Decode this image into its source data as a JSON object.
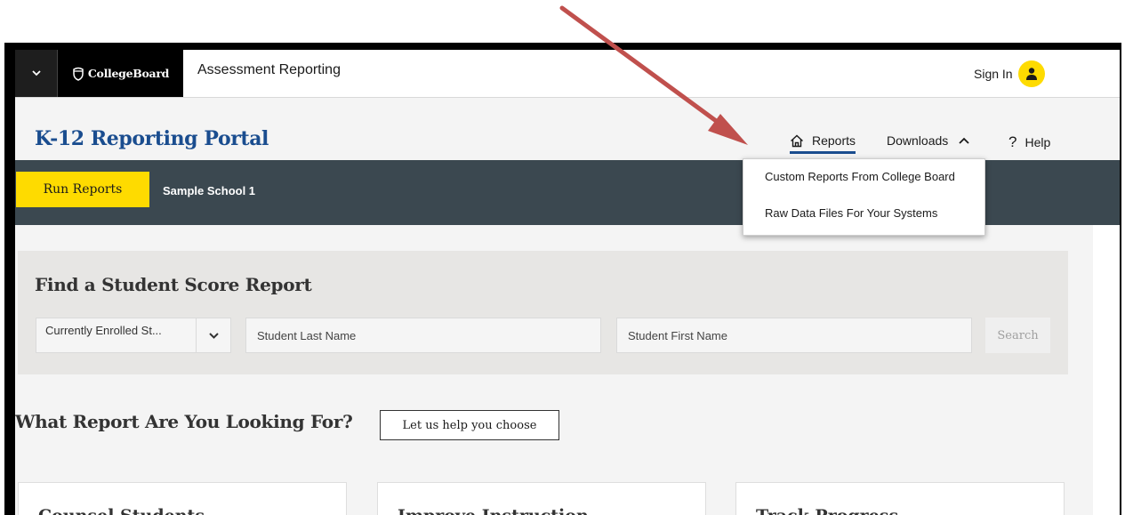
{
  "header": {
    "brand": "CollegeBoard",
    "app_name": "Assessment Reporting",
    "sign_in_label": "Sign In"
  },
  "portal": {
    "title": "K-12 Reporting Portal"
  },
  "nav": {
    "reports_label": "Reports",
    "downloads_label": "Downloads",
    "help_label": "Help"
  },
  "downloads_menu": {
    "items": [
      "Custom Reports From College Board",
      "Raw Data Files For Your Systems"
    ]
  },
  "subbar": {
    "run_reports_label": "Run Reports",
    "school_name": "Sample School 1"
  },
  "search": {
    "title": "Find a Student Score Report",
    "enrollment_selected": "Currently Enrolled St...",
    "last_name_placeholder": "Student Last Name",
    "first_name_placeholder": "Student First Name",
    "search_label": "Search"
  },
  "reports_section": {
    "title": "What Report Are You Looking For?",
    "help_choose_label": "Let us help you choose",
    "cards": [
      "Counsel Students",
      "Improve Instruction",
      "Track Progress"
    ]
  },
  "colors": {
    "brand_yellow": "#fedb00",
    "portal_blue": "#1a4d8f",
    "dark_bar": "#3b4850",
    "annotation_arrow": "#c0504d"
  },
  "icons": {
    "menu_toggle": "chevron-down-icon",
    "logo": "acorn-icon",
    "avatar": "user-icon",
    "reports": "home-icon",
    "downloads": "chevron-up-icon",
    "help": "question-icon",
    "select": "chevron-down-icon"
  }
}
